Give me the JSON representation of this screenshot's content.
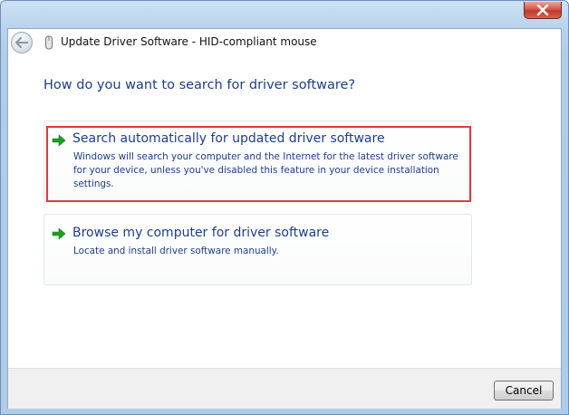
{
  "window": {
    "title": "Update Driver Software - HID-compliant mouse",
    "close_icon": "close-icon",
    "back_icon": "back-arrow-icon",
    "device_icon": "mouse-device-icon"
  },
  "question": "How do you want to search for driver software?",
  "options": [
    {
      "title": "Search automatically for updated driver software",
      "description": "Windows will search your computer and the Internet for the latest driver software for your device, unless you've disabled this feature in your device installation settings.",
      "icon": "green-arrow-icon",
      "highlighted": true
    },
    {
      "title": "Browse my computer for driver software",
      "description": "Locate and install driver software manually.",
      "icon": "green-arrow-icon",
      "highlighted": false
    }
  ],
  "footer": {
    "cancel_label": "Cancel"
  },
  "colors": {
    "link_text": "#1e3d8a",
    "arrow": "#1e9e24",
    "highlight_border": "#e03a3a",
    "close_button": "#c0392b"
  }
}
